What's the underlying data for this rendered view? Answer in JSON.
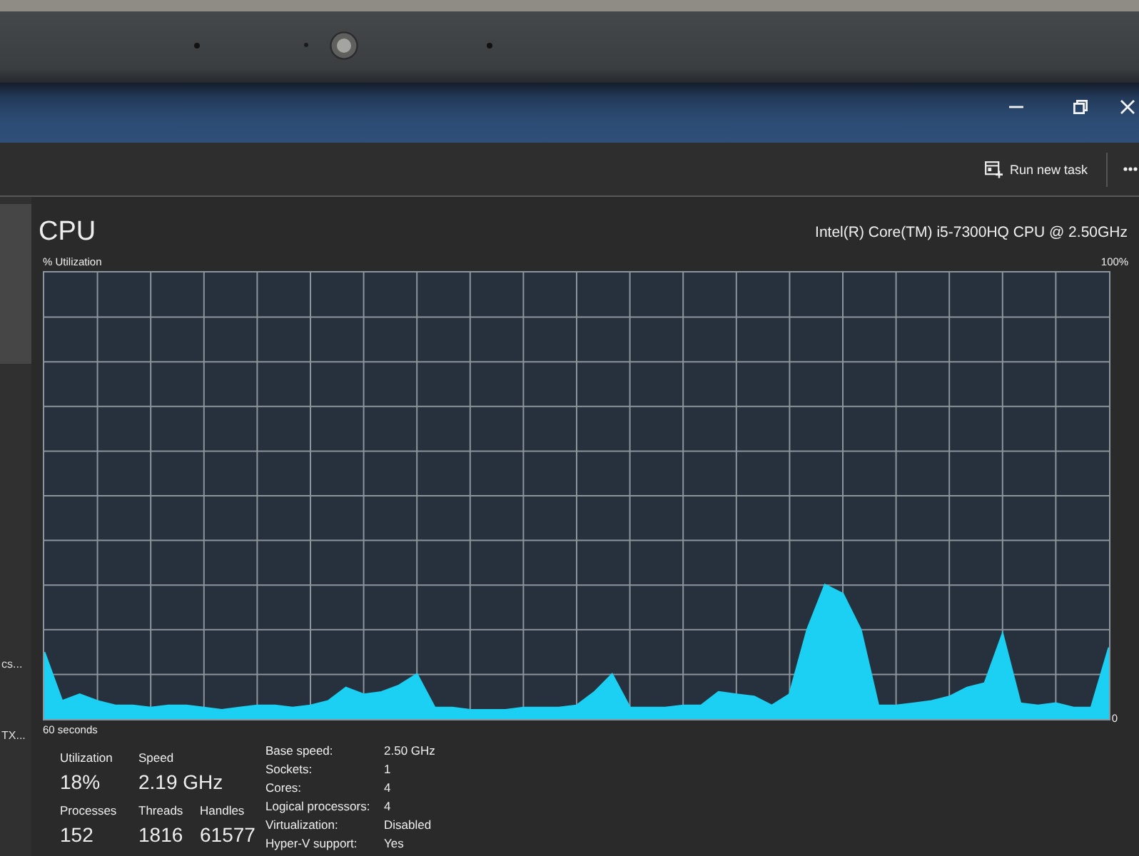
{
  "command_bar": {
    "run_new_task": "Run new task"
  },
  "sidebar": {
    "items": [
      {
        "selected": true
      },
      {
        "label": "cs...",
        "selected": false
      },
      {
        "label": "TX...",
        "selected": false
      }
    ]
  },
  "performance": {
    "title": "CPU",
    "processor": "Intel(R) Core(TM) i5-7300HQ CPU @ 2.50GHz",
    "chart_data": {
      "type": "area",
      "ylabel": "% Utilization",
      "xlabel": "60 seconds",
      "ylim": [
        0,
        100
      ],
      "yticks": [
        {
          "value": 0,
          "label": "0"
        },
        {
          "value": 100,
          "label": "100%"
        }
      ],
      "grid": true,
      "values": [
        15,
        4,
        5.5,
        4,
        3,
        3,
        2.5,
        3,
        3,
        2.5,
        2,
        2.5,
        3,
        3,
        2.5,
        3,
        4,
        7,
        5.5,
        6,
        7.5,
        10,
        2.5,
        2.5,
        2,
        2,
        2,
        2.5,
        2.5,
        2.5,
        3,
        6,
        10,
        2.5,
        2.5,
        2.5,
        3,
        3,
        6,
        5.5,
        5,
        3,
        5.5,
        20,
        30,
        28,
        20,
        3,
        3,
        3.5,
        4,
        5,
        7,
        8,
        19,
        3.5,
        3,
        3.5,
        2.5,
        2.5,
        16
      ]
    },
    "stat_rows": [
      [
        {
          "label": "Utilization",
          "value": "18%"
        },
        {
          "label": "Speed",
          "value": "2.19 GHz"
        }
      ],
      [
        {
          "label": "Processes",
          "value": "152"
        },
        {
          "label": "Threads",
          "value": "1816"
        },
        {
          "label": "Handles",
          "value": "61577"
        }
      ]
    ],
    "details": [
      {
        "label": "Base speed:",
        "value": "2.50 GHz"
      },
      {
        "label": "Sockets:",
        "value": "1"
      },
      {
        "label": "Cores:",
        "value": "4"
      },
      {
        "label": "Logical processors:",
        "value": "4"
      },
      {
        "label": "Virtualization:",
        "value": "Disabled"
      },
      {
        "label": "Hyper-V support:",
        "value": "Yes"
      }
    ]
  }
}
